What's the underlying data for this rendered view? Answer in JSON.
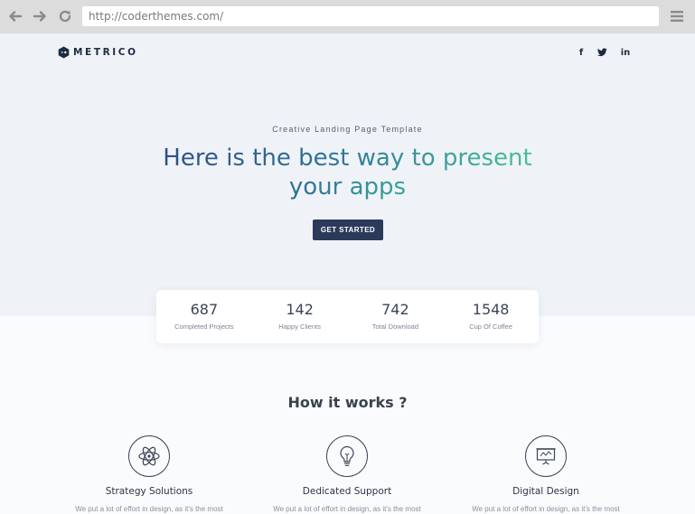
{
  "browser": {
    "url": "http://coderthemes.com/"
  },
  "header": {
    "logo_text": "METRICO",
    "social": [
      "f",
      "twitter",
      "in"
    ]
  },
  "hero": {
    "eyebrow": "Creative Landing Page Template",
    "headline_line1": "Here is the best way to present",
    "headline_line2": "your apps",
    "cta_label": "GET STARTED"
  },
  "stats": [
    {
      "value": "687",
      "label": "Completed Projects"
    },
    {
      "value": "142",
      "label": "Happy Clients"
    },
    {
      "value": "742",
      "label": "Total Download"
    },
    {
      "value": "1548",
      "label": "Cup Of Coffee"
    }
  ],
  "how_it_works": {
    "title": "How it works ?",
    "features": [
      {
        "icon": "atom-icon",
        "title": "Strategy Solutions",
        "desc": "We put a lot of effort in design, as it's the most"
      },
      {
        "icon": "lightbulb-icon",
        "title": "Dedicated Support",
        "desc": "We put a lot of effort in design, as it's the most"
      },
      {
        "icon": "presentation-icon",
        "title": "Digital Design",
        "desc": "We put a lot of effort in design, as it's the most"
      }
    ]
  },
  "colors": {
    "hero_bg": "#eff3f8",
    "cta_bg": "#2c3a5a",
    "gradient_start": "#2f4f86",
    "gradient_end": "#4cc195"
  }
}
